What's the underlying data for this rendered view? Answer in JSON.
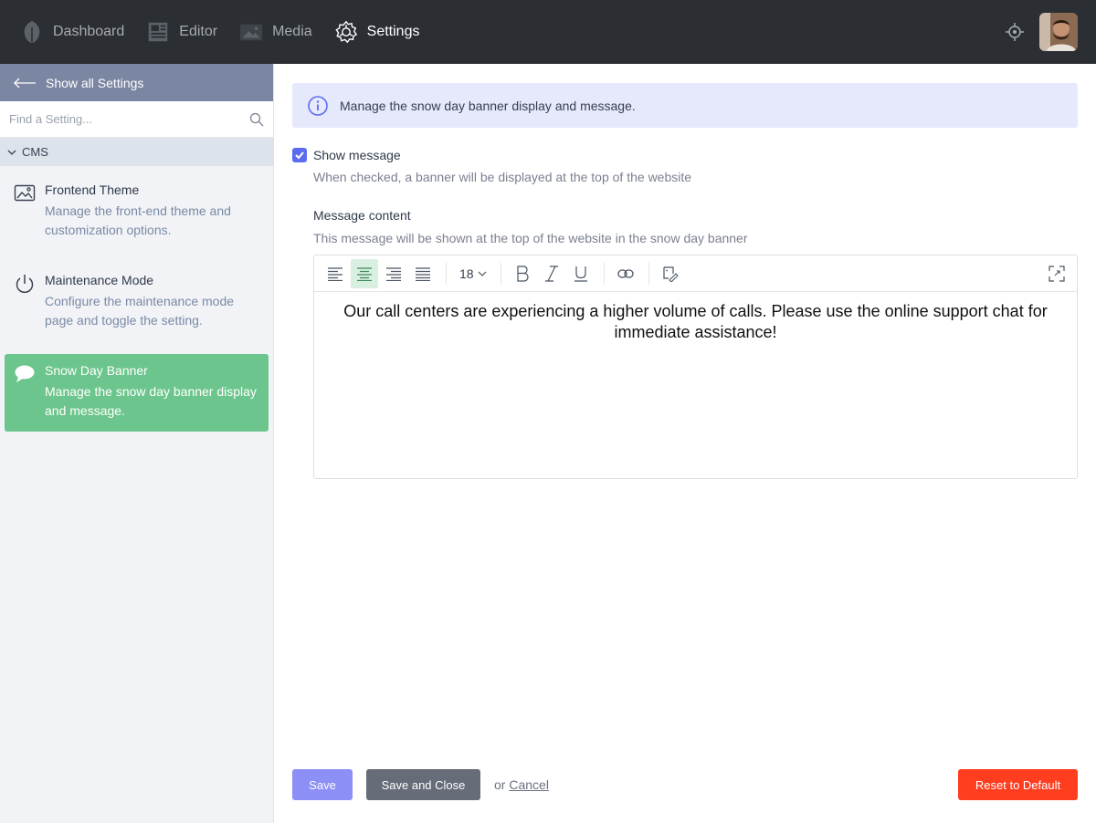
{
  "topnav": {
    "items": [
      {
        "label": "Dashboard",
        "icon": "leaf-icon"
      },
      {
        "label": "Editor",
        "icon": "newspaper-icon"
      },
      {
        "label": "Media",
        "icon": "image-icon"
      },
      {
        "label": "Settings",
        "icon": "gear-icon",
        "active": true
      }
    ],
    "right_icons": [
      "locate-icon",
      "user-avatar"
    ]
  },
  "sidebar": {
    "back_label": "Show all Settings",
    "search_placeholder": "Find a Setting...",
    "group_label": "CMS",
    "items": [
      {
        "title": "Frontend Theme",
        "desc": "Manage the front-end theme and customization options.",
        "icon": "picture-icon"
      },
      {
        "title": "Maintenance Mode",
        "desc": "Configure the maintenance mode page and toggle the setting.",
        "icon": "power-icon"
      },
      {
        "title": "Snow Day Banner",
        "desc": "Manage the snow day banner display and message.",
        "icon": "chat-bubble-icon",
        "active": true
      }
    ]
  },
  "main": {
    "info_text": "Manage the snow day banner display and message.",
    "show_message_label": "Show message",
    "show_message_checked": true,
    "show_message_help": "When checked, a banner will be displayed at the top of the website",
    "message_label": "Message content",
    "message_help": "This message will be shown at the top of the website in the snow day banner",
    "editor": {
      "font_size": "18",
      "align_active": "center",
      "content": "Our call centers are experiencing a higher volume of calls. Please use the online support chat for immediate assistance!"
    }
  },
  "footer": {
    "save_label": "Save",
    "save_close_label": "Save and Close",
    "or_text": "or",
    "cancel_label": "Cancel",
    "reset_label": "Reset to Default"
  },
  "colors": {
    "topbar": "#2b2e33",
    "sidebar_back": "#7b86a2",
    "active_item": "#6cc58c",
    "info_bg": "#e6e8fb",
    "save": "#8c8ff6",
    "save_close": "#666c78",
    "reset": "#ff3d1f"
  }
}
